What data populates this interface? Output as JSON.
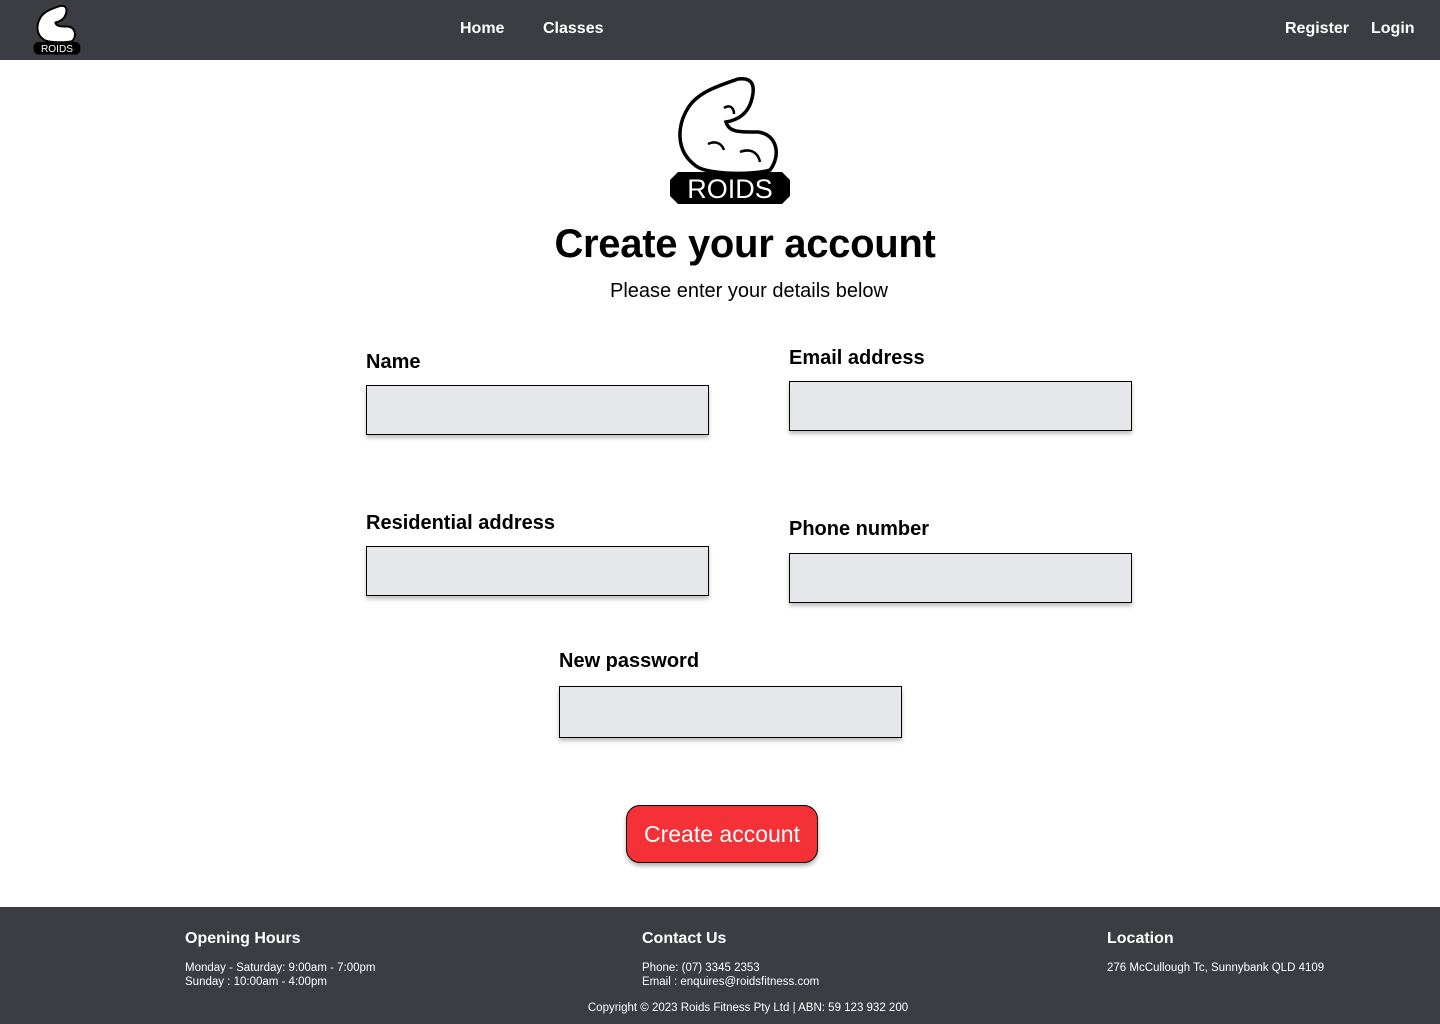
{
  "brand": {
    "logo_text": "ROIDS",
    "colors": {
      "nav_bg": "#3c3d42",
      "accent": "#f43137",
      "input_bg": "#e6e7eb"
    }
  },
  "nav": {
    "links": [
      {
        "label": "Home"
      },
      {
        "label": "Classes"
      },
      {
        "label": "Register"
      },
      {
        "label": "Login"
      }
    ]
  },
  "page": {
    "title": "Create your account",
    "subtitle": "Please enter your details below"
  },
  "form": {
    "fields": {
      "name": {
        "label": "Name",
        "value": ""
      },
      "email": {
        "label": "Email address",
        "value": ""
      },
      "residential": {
        "label": "Residential address",
        "value": ""
      },
      "phone": {
        "label": "Phone number",
        "value": ""
      },
      "password": {
        "label": "New password",
        "value": ""
      }
    },
    "submit_label": "Create account"
  },
  "footer": {
    "hours": {
      "heading": "Opening Hours",
      "lines": [
        "Monday - Saturday: 9:00am - 7:00pm",
        "Sunday : 10:00am - 4:00pm"
      ]
    },
    "contact": {
      "heading": "Contact Us",
      "lines": [
        "Phone: (07) 3345 2353",
        "Email : enquires@roidsfitness.com"
      ]
    },
    "location": {
      "heading": "Location",
      "lines": [
        "276 McCullough Tc, Sunnybank QLD 4109"
      ]
    },
    "copyright": "Copyright © 2023 Roids Fitness Pty Ltd | ABN: 59 123 932 200"
  }
}
